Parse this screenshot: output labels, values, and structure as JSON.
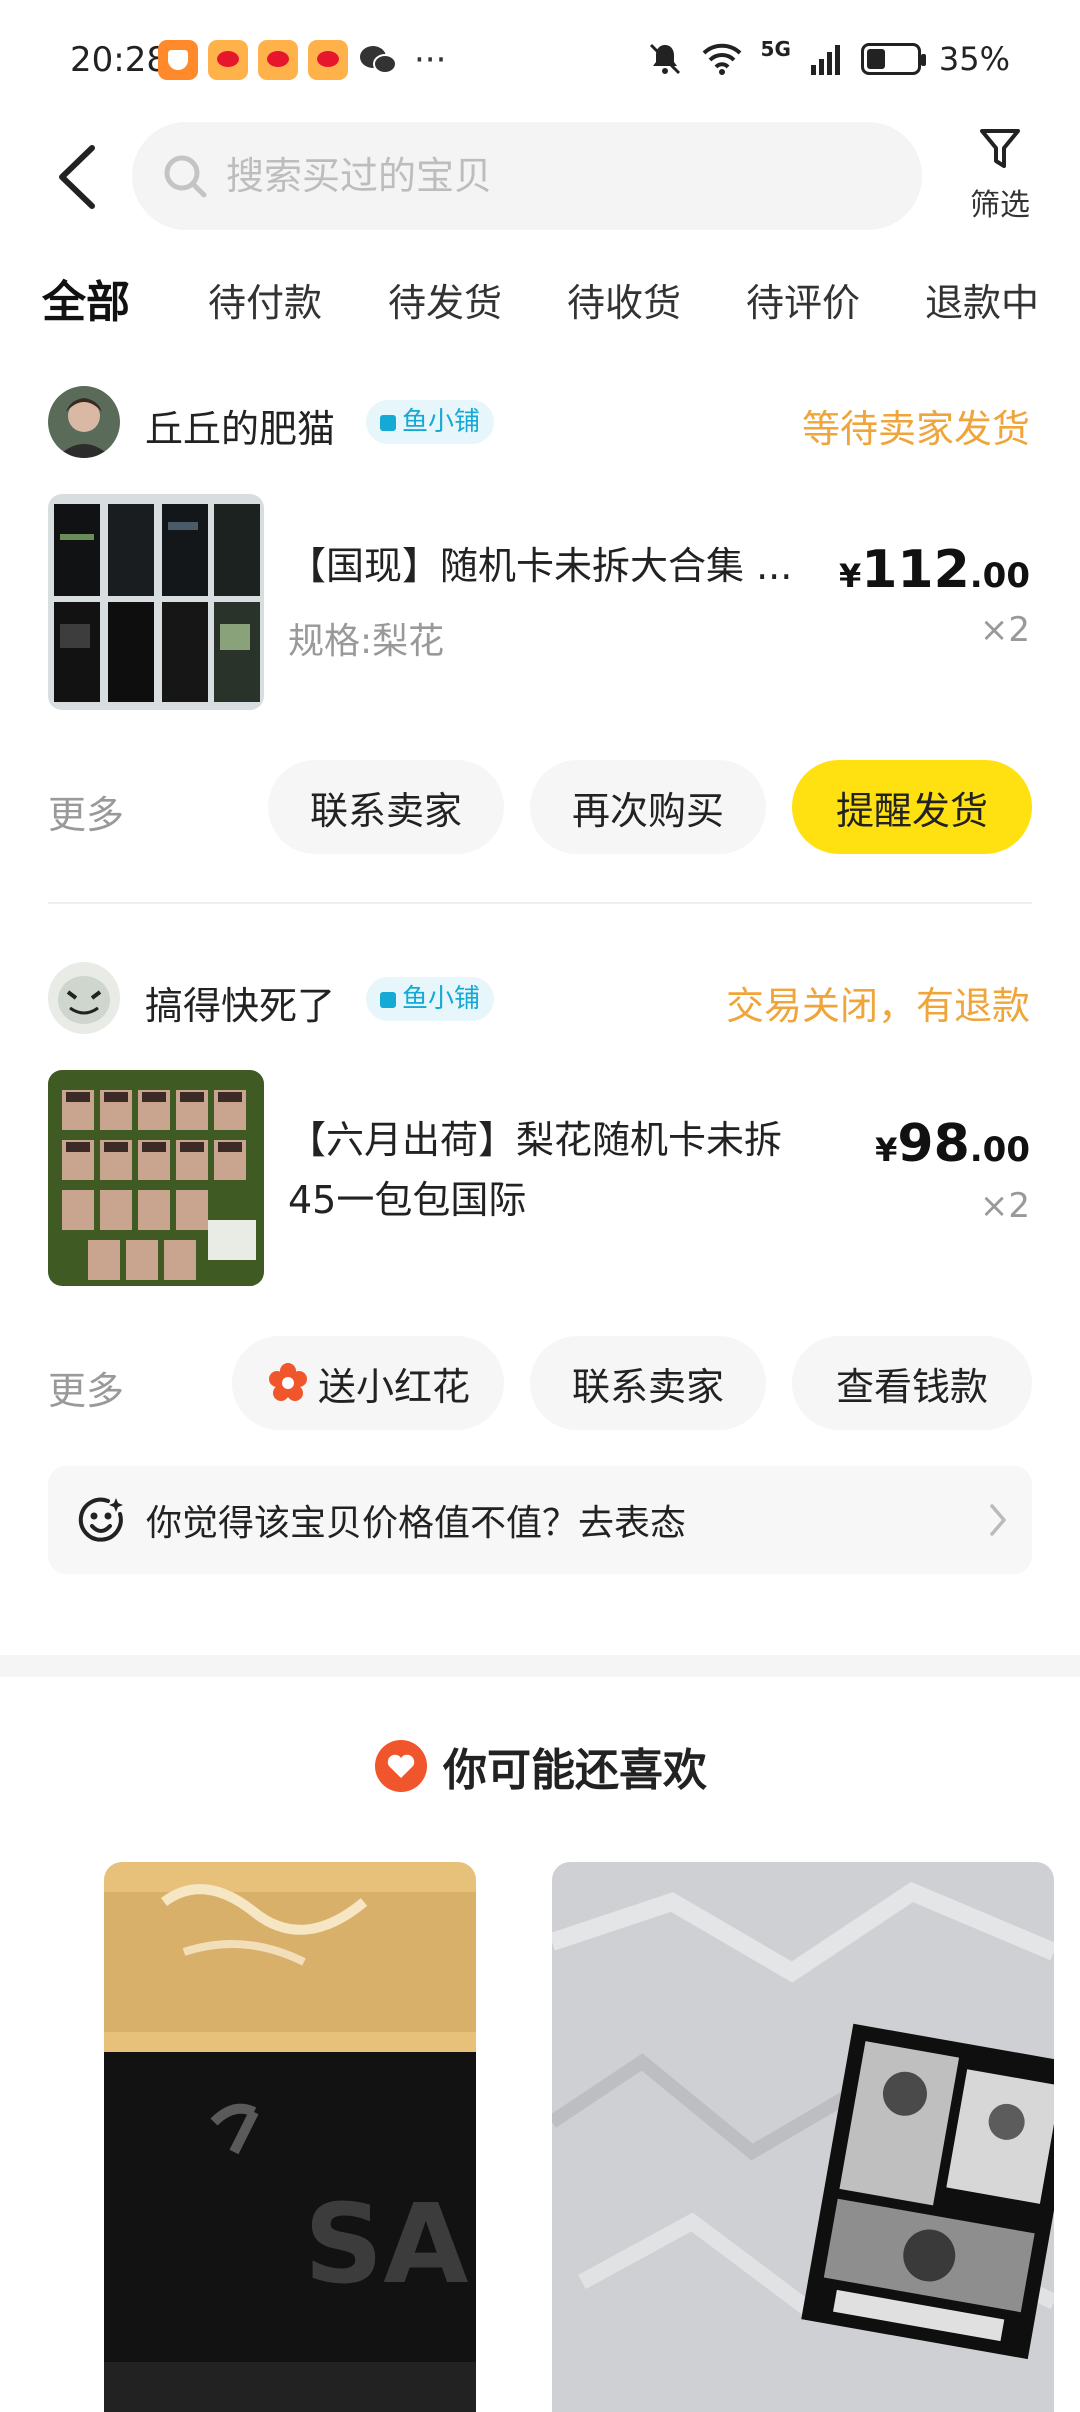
{
  "status_bar": {
    "time": "20:28",
    "network": "5G",
    "battery": "35%"
  },
  "header": {
    "search_placeholder": "搜索买过的宝贝",
    "filter_label": "筛选"
  },
  "tabs": [
    {
      "label": "全部",
      "active": true
    },
    {
      "label": "待付款"
    },
    {
      "label": "待发货"
    },
    {
      "label": "待收货"
    },
    {
      "label": "待评价"
    },
    {
      "label": "退款中"
    }
  ],
  "orders": [
    {
      "shop_name": "丘丘的肥猫",
      "shop_tag": "鱼小铺",
      "status": "等待卖家发货",
      "item_title": "【国现】随机卡未拆大合集 ...",
      "item_spec": "规格:梨花",
      "price_yen": "¥",
      "price_int": "112",
      "price_dec": ".00",
      "quantity": "×2",
      "more": "更多",
      "buttons": [
        "联系卖家",
        "再次购买",
        "提醒发货"
      ]
    },
    {
      "shop_name": "搞得快死了",
      "shop_tag": "鱼小铺",
      "status": "交易关闭，有退款",
      "item_title_line1": "【六月出荷】梨花随机卡未拆",
      "item_title_line2": "45一包包国际",
      "price_yen": "¥",
      "price_int": "98",
      "price_dec": ".00",
      "quantity": "×2",
      "more": "更多",
      "buttons": [
        "送小红花",
        "联系卖家",
        "查看钱款"
      ]
    }
  ],
  "opinion_prompt": "你觉得该宝贝价格值不值？去表态",
  "recommend_title": "你可能还喜欢",
  "colors": {
    "accent_yellow": "#ffe010",
    "status_orange": "#f0a53a",
    "tag_blue": "#15a9d6",
    "heart_red": "#f0552b"
  }
}
